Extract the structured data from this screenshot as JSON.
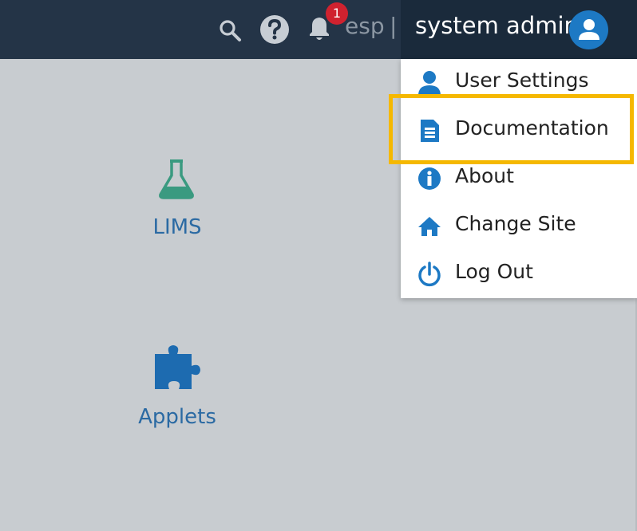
{
  "header": {
    "notification_count": "1",
    "site_label": "esp",
    "divider": "|",
    "user_name": "system admin"
  },
  "apps": [
    {
      "label": "LIMS",
      "icon": "flask-icon",
      "color": "#3a9a80"
    },
    {
      "label": "Applets",
      "icon": "puzzle-icon",
      "color": "#1d6bb0"
    }
  ],
  "user_menu": {
    "items": [
      {
        "label": "User Settings",
        "icon": "user-icon"
      },
      {
        "label": "Documentation",
        "icon": "document-icon"
      },
      {
        "label": "About",
        "icon": "info-icon"
      },
      {
        "label": "Change Site",
        "icon": "home-icon"
      },
      {
        "label": "Log Out",
        "icon": "power-icon"
      }
    ],
    "highlighted_item": "Documentation"
  },
  "colors": {
    "header_bg": "#243447",
    "accent": "#1d79c4",
    "highlight": "#f5b800",
    "badge": "#d0222f"
  }
}
